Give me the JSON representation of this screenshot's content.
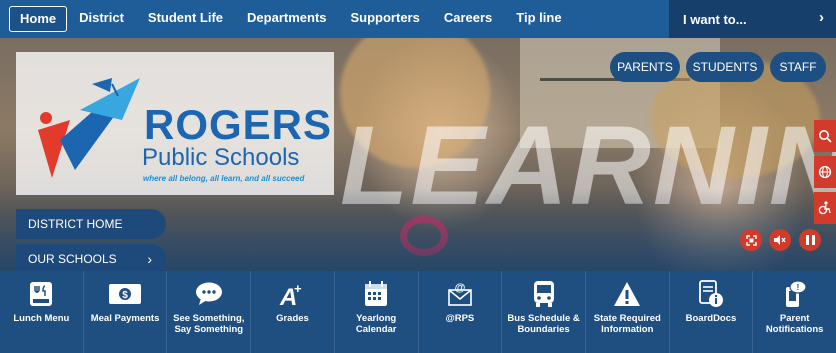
{
  "nav": {
    "items": [
      "Home",
      "District",
      "Student Life",
      "Departments",
      "Supporters",
      "Careers",
      "Tip line"
    ],
    "active": "Home",
    "i_want": "I want to..."
  },
  "hero": {
    "background_word": "LEARNING",
    "logo": {
      "title": "ROGERS",
      "subtitle": "Public Schools",
      "tagline": "where all belong, all learn, and all succeed"
    },
    "side_buttons": {
      "district_home": "DISTRICT HOME",
      "our_schools": "OUR SCHOOLS"
    },
    "audience_buttons": [
      "PARENTS",
      "STUDENTS",
      "STAFF"
    ],
    "side_tools": [
      "search-icon",
      "globe-icon",
      "accessibility-icon"
    ],
    "media_controls": [
      "fullscreen-icon",
      "mute-icon",
      "pause-icon"
    ]
  },
  "quick_links": [
    {
      "label": "Lunch Menu",
      "icon": "menu-board-icon"
    },
    {
      "label": "Meal Payments",
      "icon": "dollar-bill-icon"
    },
    {
      "label": "See Something, Say Something",
      "icon": "speech-bubble-icon"
    },
    {
      "label": "Grades",
      "icon": "grade-a-plus-icon"
    },
    {
      "label": "Yearlong Calendar",
      "icon": "calendar-icon"
    },
    {
      "label": "@RPS",
      "icon": "at-mail-icon"
    },
    {
      "label": "Bus Schedule & Boundaries",
      "icon": "bus-icon"
    },
    {
      "label": "State Required Information",
      "icon": "warning-icon"
    },
    {
      "label": "BoardDocs",
      "icon": "document-info-icon"
    },
    {
      "label": "Parent Notifications",
      "icon": "phone-message-icon"
    }
  ],
  "colors": {
    "nav": "#1e5d97",
    "accent_red": "#d23a2b",
    "brand_blue": "#1c66b1",
    "quick_bar": "#1f4f80"
  }
}
